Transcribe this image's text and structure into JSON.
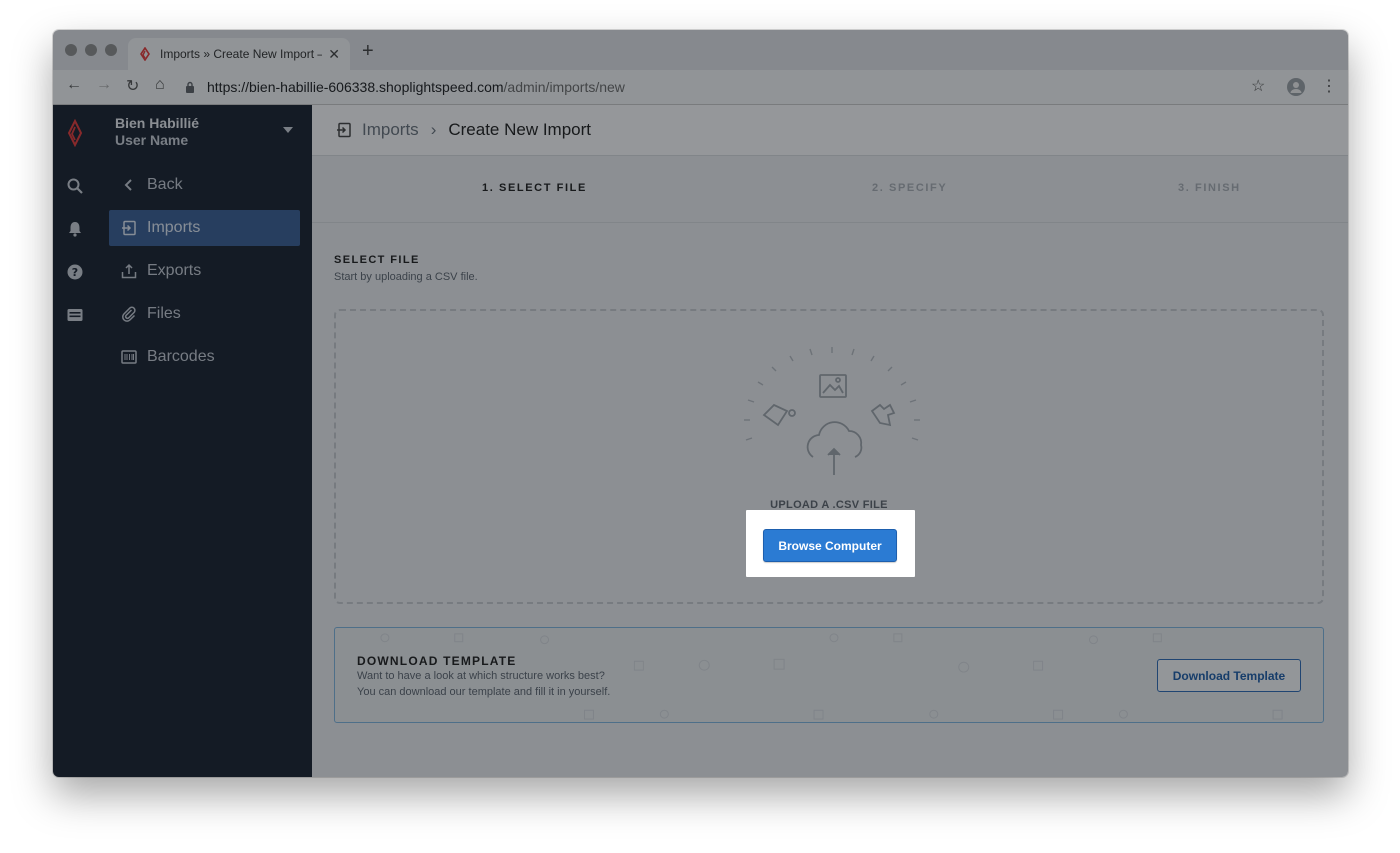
{
  "browser": {
    "tab_title": "Imports » Create New Import – ",
    "url_host": "https://bien-habillie-606338.shoplightspeed.com",
    "url_path": "/admin/imports/new"
  },
  "sidebar": {
    "store_name": "Bien Habillié",
    "user_name": "User Name",
    "back_label": "Back",
    "items": [
      {
        "label": "Imports",
        "icon": "import-icon",
        "active": true
      },
      {
        "label": "Exports",
        "icon": "export-icon",
        "active": false
      },
      {
        "label": "Files",
        "icon": "paperclip-icon",
        "active": false
      },
      {
        "label": "Barcodes",
        "icon": "barcode-icon",
        "active": false
      }
    ]
  },
  "header": {
    "breadcrumb_root": "Imports",
    "breadcrumb_current": "Create New Import"
  },
  "steps": [
    {
      "label": "1. SELECT FILE",
      "active": true
    },
    {
      "label": "2. SPECIFY",
      "active": false
    },
    {
      "label": "3. FINISH",
      "active": false
    }
  ],
  "select_file": {
    "title": "SELECT FILE",
    "subtitle": "Start by uploading a CSV file.",
    "upload_label": "UPLOAD A .CSV FILE",
    "browse_button": "Browse Computer"
  },
  "template": {
    "title": "DOWNLOAD TEMPLATE",
    "line1": "Want to have a look at which structure works best?",
    "line2": "You can download our template and fill it in yourself.",
    "button": "Download Template"
  },
  "colors": {
    "sidebar_bg": "#1b2431",
    "active_nav": "#3b5f95",
    "primary_button": "#2b7bd3",
    "brand_red": "#e23b3b"
  }
}
